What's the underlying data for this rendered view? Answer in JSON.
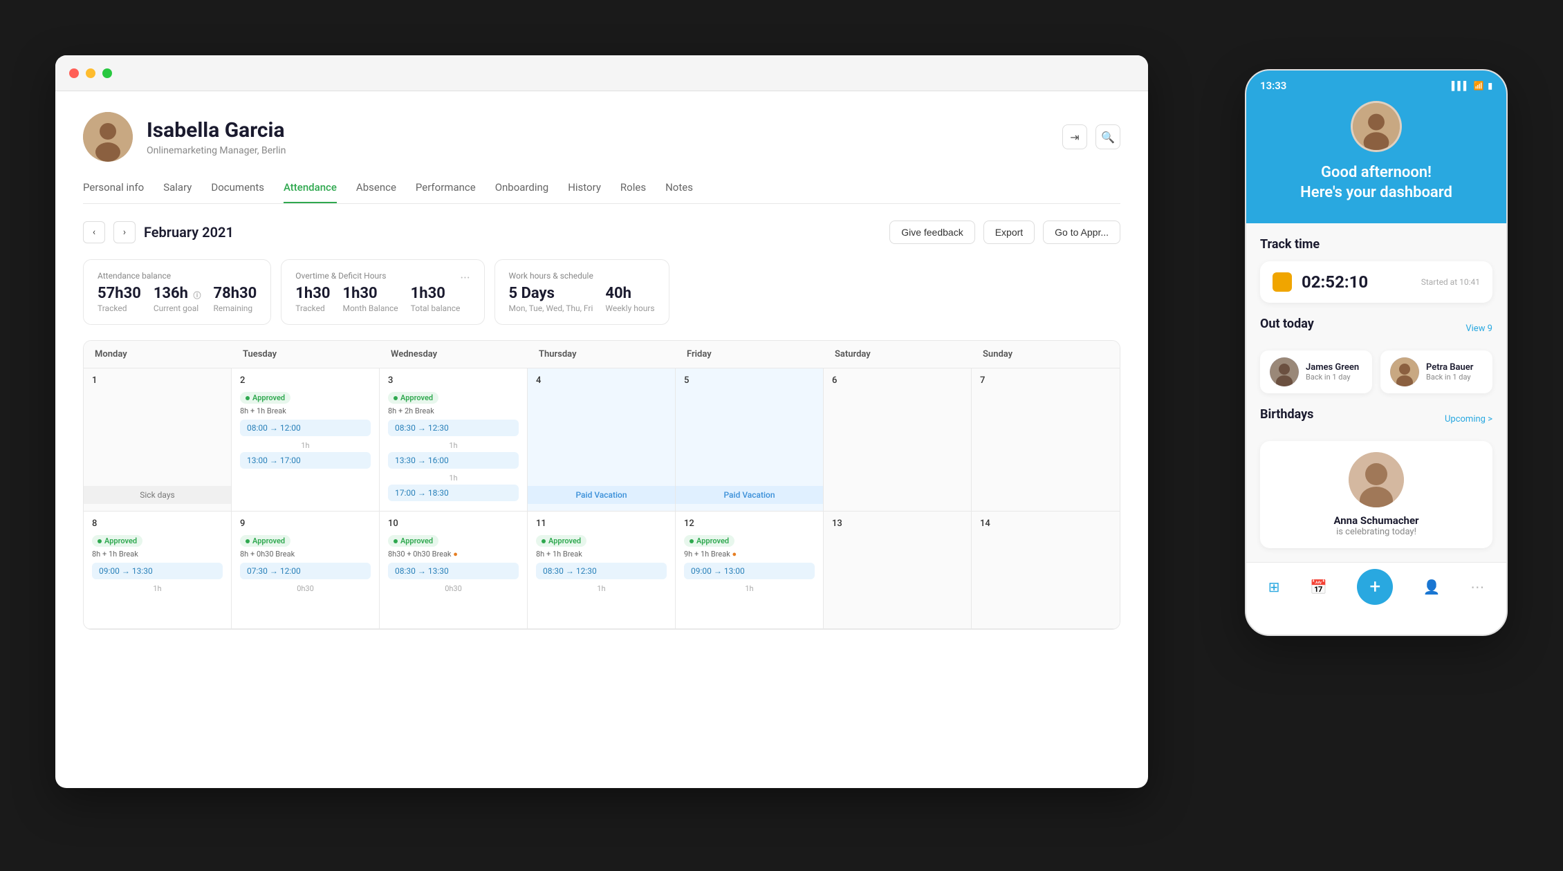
{
  "desktop": {
    "titlebar": {
      "lights": [
        "red",
        "yellow",
        "green"
      ]
    },
    "profile": {
      "name": "Isabella Garcia",
      "subtitle": "Onlinemarketing Manager, Berlin"
    },
    "nav_tabs": [
      {
        "label": "Personal info",
        "active": false
      },
      {
        "label": "Salary",
        "active": false
      },
      {
        "label": "Documents",
        "active": false
      },
      {
        "label": "Attendance",
        "active": true
      },
      {
        "label": "Absence",
        "active": false
      },
      {
        "label": "Performance",
        "active": false
      },
      {
        "label": "Onboarding",
        "active": false
      },
      {
        "label": "History",
        "active": false
      },
      {
        "label": "Roles",
        "active": false
      },
      {
        "label": "Notes",
        "active": false
      }
    ],
    "toolbar": {
      "month": "February 2021",
      "give_feedback": "Give feedback",
      "export": "Export",
      "go_to_approval": "Go to Appr..."
    },
    "stats": [
      {
        "label": "Attendance balance",
        "values": [
          {
            "val": "57h30",
            "sub": "Tracked"
          },
          {
            "val": "136h",
            "sub": "Current goal",
            "info": "ⓘ"
          },
          {
            "val": "78h30",
            "sub": "Remaining"
          }
        ]
      },
      {
        "label": "Overtime & Deficit Hours",
        "values": [
          {
            "val": "1h30",
            "sub": "Tracked"
          },
          {
            "val": "1h30",
            "sub": "Month Balance"
          },
          {
            "val": "1h30",
            "sub": "Total balance"
          }
        ]
      },
      {
        "label": "Work hours & schedule",
        "values": [
          {
            "val": "5 Days",
            "sub": "Mon, Tue, Wed, Thu, Fri"
          },
          {
            "val": "40h",
            "sub": "Weekly hours"
          }
        ]
      }
    ],
    "calendar": {
      "headers": [
        "Monday",
        "Tuesday",
        "Wednesday",
        "Thursday",
        "Friday",
        "Saturday",
        "Sunday"
      ],
      "week1": [
        {
          "day": "1",
          "type": "sick",
          "label": "Sick days"
        },
        {
          "day": "2",
          "type": "work",
          "approved": true,
          "break": "8h + 1h Break",
          "blocks": [
            {
              "start": "08:00",
              "end": "12:00"
            },
            {
              "gap": "1h"
            },
            {
              "start": "13:00",
              "end": "17:00"
            }
          ]
        },
        {
          "day": "3",
          "type": "work",
          "approved": true,
          "break": "8h + 2h Break",
          "blocks": [
            {
              "start": "08:30",
              "end": "12:30"
            },
            {
              "gap": "1h"
            },
            {
              "start": "13:30",
              "end": "16:00"
            },
            {
              "gap": "1h"
            },
            {
              "start": "17:00",
              "end": "18:30"
            }
          ]
        },
        {
          "day": "4",
          "type": "vacation",
          "label": "Paid Vacation"
        },
        {
          "day": "5",
          "type": "vacation",
          "label": "Paid Vacation"
        },
        {
          "day": "6",
          "type": "empty"
        },
        {
          "day": "7",
          "type": "empty"
        }
      ],
      "week2": [
        {
          "day": "8",
          "type": "work",
          "approved": true,
          "break": "8h + 1h Break",
          "blocks": [
            {
              "start": "09:00",
              "end": "13:30"
            },
            {
              "gap": "1h"
            }
          ]
        },
        {
          "day": "9",
          "type": "work",
          "approved": true,
          "break": "8h + 0h30 Break",
          "blocks": [
            {
              "start": "07:30",
              "end": "12:00"
            },
            {
              "gap": "0h30"
            }
          ]
        },
        {
          "day": "10",
          "type": "work",
          "approved": true,
          "break": "8h30 + 0h30 Break",
          "info": true,
          "blocks": [
            {
              "start": "08:30",
              "end": "13:30"
            },
            {
              "gap": "0h30"
            }
          ]
        },
        {
          "day": "11",
          "type": "work",
          "approved": true,
          "break": "8h + 1h Break",
          "blocks": [
            {
              "start": "08:30",
              "end": "12:30"
            },
            {
              "gap": "1h"
            }
          ]
        },
        {
          "day": "12",
          "type": "work",
          "approved": true,
          "break": "9h + 1h Break",
          "info": true,
          "blocks": [
            {
              "start": "09:00",
              "end": "13:00"
            },
            {
              "gap": "1h"
            }
          ]
        },
        {
          "day": "13",
          "type": "empty"
        },
        {
          "day": "14",
          "type": "empty"
        }
      ]
    }
  },
  "mobile": {
    "status_bar": {
      "time": "13:33",
      "signal": "▌▌▌",
      "wifi": "WiFi",
      "battery": "🔋"
    },
    "greeting": "Good afternoon!\nHere's your dashboard",
    "sections": {
      "track_time": {
        "title": "Track time",
        "timer": "02:52:10",
        "started": "Started at 10:41"
      },
      "out_today": {
        "title": "Out today",
        "view_label": "View 9",
        "people": [
          {
            "name": "James Green",
            "status": "Back in 1 day"
          },
          {
            "name": "Petra Bauer",
            "status": "Back in 1 day"
          }
        ]
      },
      "birthdays": {
        "title": "Birthdays",
        "upcoming_label": "Upcoming >",
        "person": {
          "name": "Anna Schumacher",
          "msg": "is celebrating today!"
        }
      }
    },
    "bottom_nav": [
      {
        "icon": "⊞",
        "label": "home",
        "active": true
      },
      {
        "icon": "📅",
        "label": "calendar"
      },
      {
        "icon": "+",
        "label": "add",
        "special": true
      },
      {
        "icon": "👤",
        "label": "people"
      },
      {
        "icon": "⋯",
        "label": "more"
      }
    ]
  }
}
